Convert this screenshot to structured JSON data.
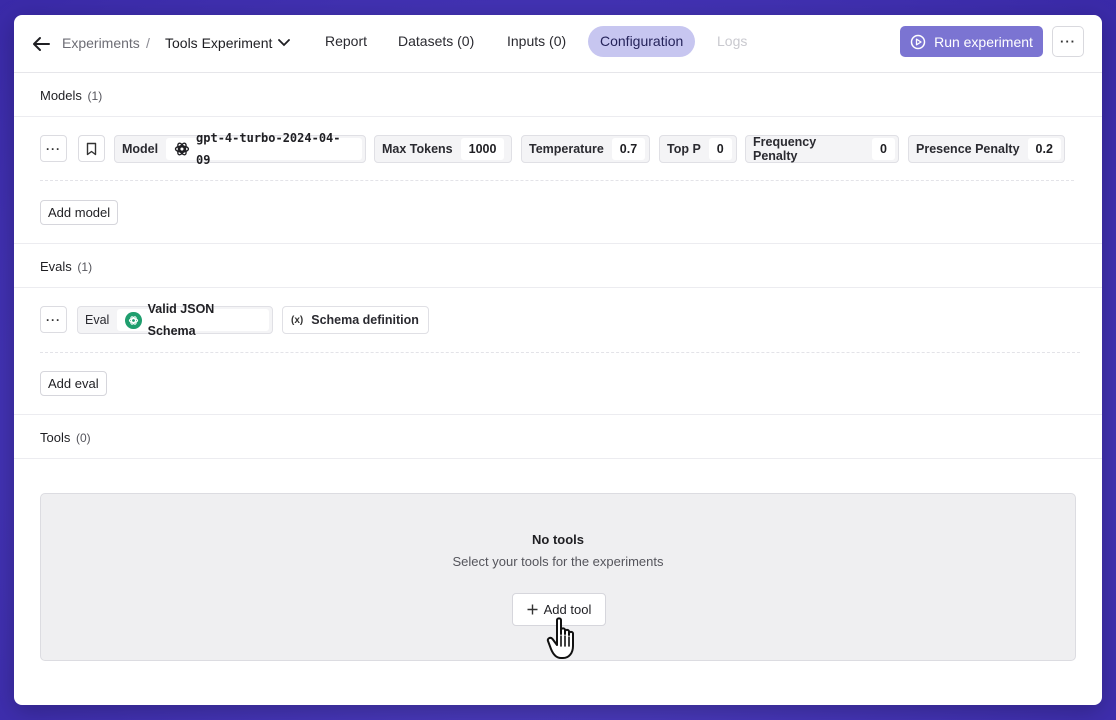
{
  "header": {
    "breadcrumb_root": "Experiments",
    "breadcrumb_sep": "/",
    "experiment_name": "Tools Experiment",
    "tabs": [
      {
        "label": "Report"
      },
      {
        "label": "Datasets (0)"
      },
      {
        "label": "Inputs (0)"
      },
      {
        "label": "Configuration"
      },
      {
        "label": "Logs"
      }
    ],
    "active_tab": "Configuration",
    "run_label": "Run experiment",
    "more_label": "···"
  },
  "models": {
    "title": "Models",
    "count": "(1)",
    "more_label": "···",
    "params": {
      "model_key": "Model",
      "model_value": "gpt-4-turbo-2024-04-09",
      "max_tokens_key": "Max Tokens",
      "max_tokens_value": "1000",
      "temperature_key": "Temperature",
      "temperature_value": "0.7",
      "top_p_key": "Top P",
      "top_p_value": "0",
      "freq_key": "Frequency Penalty",
      "freq_value": "0",
      "presence_key": "Presence Penalty",
      "presence_value": "0.2"
    },
    "add_label": "Add model"
  },
  "evals": {
    "title": "Evals",
    "count": "(1)",
    "more_label": "···",
    "eval_key": "Eval",
    "eval_value": "Valid JSON Schema",
    "var_icon_text": "(x)",
    "var_label": "Schema definition",
    "add_label": "Add eval"
  },
  "tools": {
    "title": "Tools",
    "count": "(0)",
    "empty_title": "No tools",
    "empty_subtitle": "Select your tools for the experiments",
    "add_label": "Add tool"
  },
  "colors": {
    "accent": "#7b74d2",
    "active_tab_bg": "#c7c6f0",
    "eval_badge": "#1f9e6e"
  }
}
